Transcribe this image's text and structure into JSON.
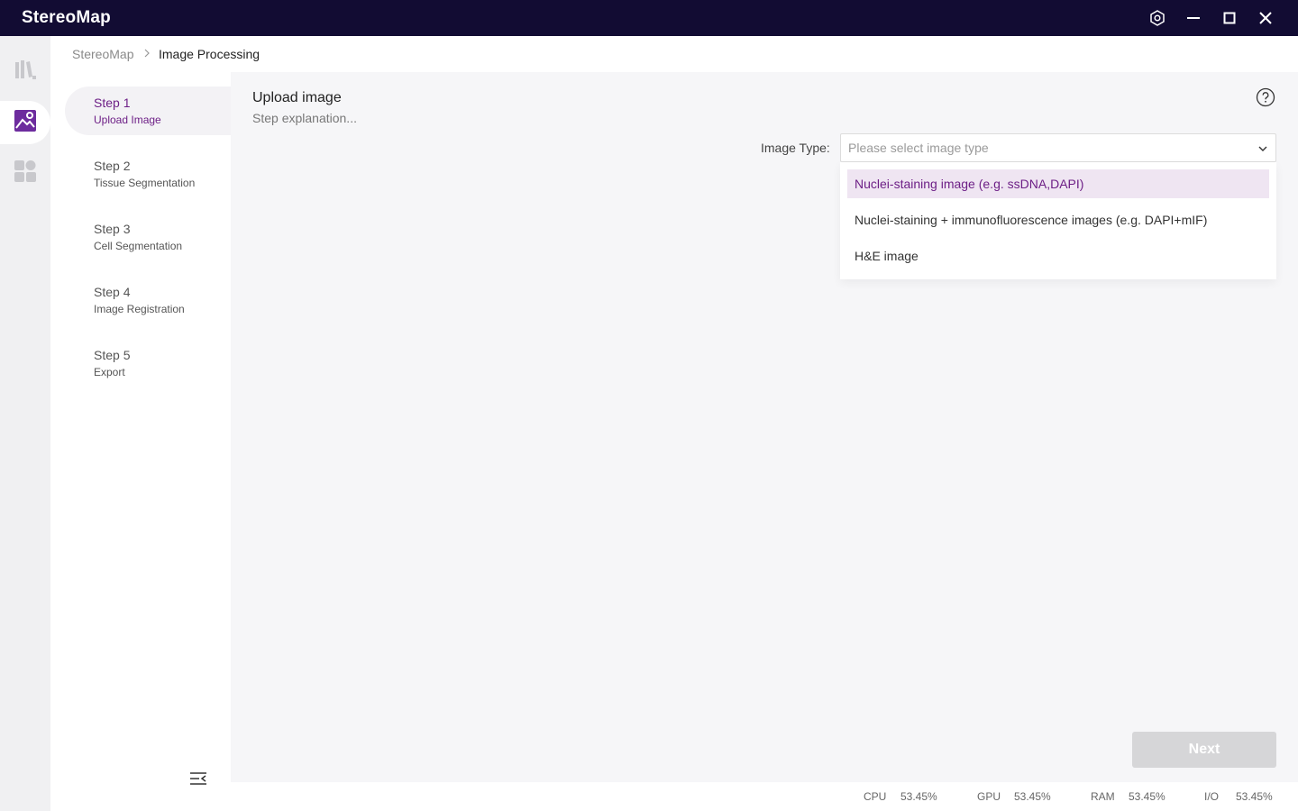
{
  "app": {
    "title": "StereoMap"
  },
  "breadcrumb": {
    "root": "StereoMap",
    "current": "Image Processing"
  },
  "steps": [
    {
      "num": "Step 1",
      "name": "Upload Image",
      "active": true
    },
    {
      "num": "Step 2",
      "name": "Tissue Segmentation",
      "active": false
    },
    {
      "num": "Step 3",
      "name": "Cell Segmentation",
      "active": false
    },
    {
      "num": "Step 4",
      "name": "Image Registration",
      "active": false
    },
    {
      "num": "Step 5",
      "name": "Export",
      "active": false
    }
  ],
  "main": {
    "title": "Upload image",
    "subtitle": "Step explanation...",
    "image_type_label": "Image Type:",
    "select_placeholder": "Please select image type",
    "options": [
      "Nuclei-staining image (e.g. ssDNA,DAPI)",
      "Nuclei-staining + immunofluorescence images (e.g. DAPI+mIF)",
      "H&E image"
    ],
    "highlighted_option_index": 0,
    "next_label": "Next"
  },
  "status": [
    {
      "label": "CPU",
      "value": "53.45%"
    },
    {
      "label": "GPU",
      "value": "53.45%"
    },
    {
      "label": "RAM",
      "value": "53.45%"
    },
    {
      "label": "I/O",
      "value": "53.45%"
    }
  ],
  "colors": {
    "titlebar": "#120c33",
    "accent": "#6d1f86",
    "highlight_bg": "#efe5f2",
    "disabled_button": "#d6d6d8"
  },
  "icons": {
    "settings": "hexagon-gear-icon",
    "minimize": "minimize-icon",
    "maximize": "maximize-icon",
    "close": "close-icon",
    "help": "question-circle-icon",
    "dropdown": "chevron-down-icon",
    "collapse": "collapse-menu-icon"
  }
}
